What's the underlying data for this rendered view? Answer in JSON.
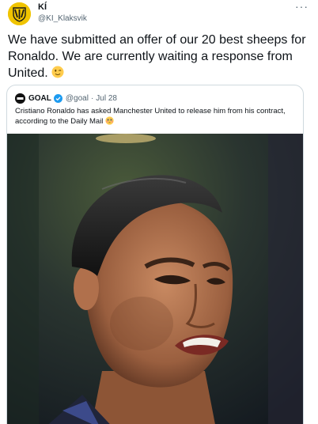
{
  "tweet": {
    "author": {
      "display_name": "KÍ",
      "handle": "@KI_Klaksvik",
      "avatar_icon": "club-crest-icon"
    },
    "more_label": "···",
    "text": "We have submitted an offer of our 20 best sheeps for Ronaldo. We are currently waiting a response from United.",
    "emoji_icon": "winking-face-emoji-icon"
  },
  "quoted_tweet": {
    "author": {
      "display_name": "GOAL",
      "handle": "@goal",
      "verified": true,
      "avatar_icon": "goal-logo-icon"
    },
    "date": "Jul 28",
    "separator": "·",
    "text": "Cristiano Ronaldo has asked Manchester United to release him from his contract, according to the Daily Mail",
    "emoji_icon": "flushed-face-emoji-icon",
    "image_icon": "photo-footballer-portrait"
  },
  "colors": {
    "text_primary": "#0f1419",
    "text_secondary": "#536471",
    "border": "#cfd9de",
    "verified_blue": "#1d9bf0",
    "crest_yellow": "#f0c400"
  }
}
